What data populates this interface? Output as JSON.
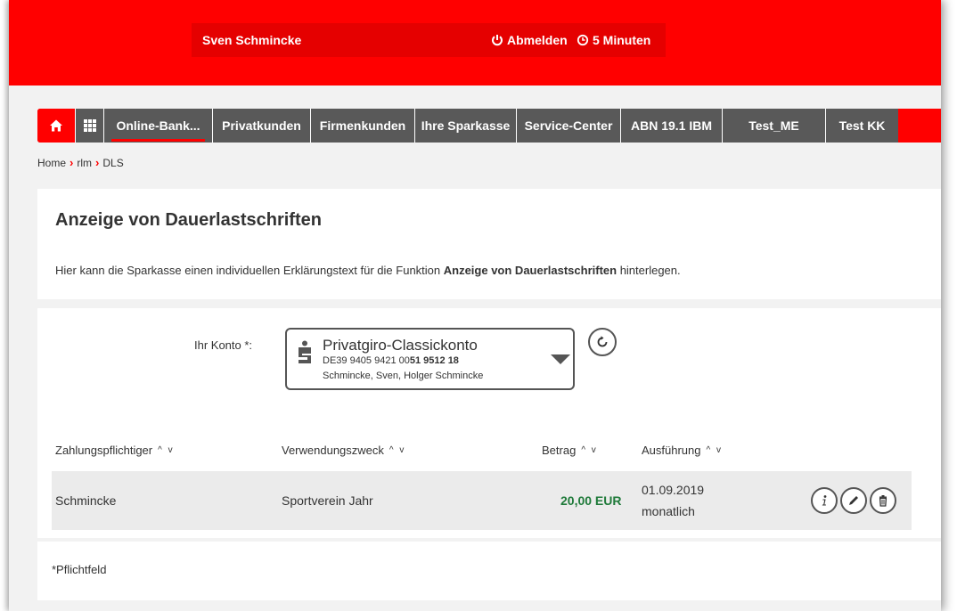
{
  "header": {
    "user_name": "Sven Schmincke",
    "logout_label": "Abmelden",
    "session_timer": "5 Minuten",
    "colors": {
      "brand_red": "#ff0000",
      "nav_gray": "#595959"
    }
  },
  "nav": {
    "home_icon": "home-icon",
    "apps_icon": "apps-grid-icon",
    "items": [
      {
        "label": "Online-Bank..."
      },
      {
        "label": "Privatkunden"
      },
      {
        "label": "Firmenkunden"
      },
      {
        "label": "Ihre Sparkasse"
      },
      {
        "label": "Service-Center"
      },
      {
        "label": "ABN 19.1 IBM"
      },
      {
        "label": "Test_ME"
      },
      {
        "label": "Test KK"
      }
    ]
  },
  "breadcrumb": [
    "Home",
    "rlm",
    "DLS"
  ],
  "intro": {
    "title": "Anzeige von Dauerlastschriften",
    "desc_before": "Hier kann die Sparkasse einen individuellen Erklärungstext für die Funktion ",
    "desc_bold": "Anzeige von Dauerlastschriften",
    "desc_after": " hinterlegen."
  },
  "konto": {
    "label": "Ihr Konto *:",
    "name": "Privatgiro-Classickonto",
    "iban_prefix": "DE39 9405 9421 00",
    "iban_bold": "51 9512 18",
    "owner": "Schmincke, Sven, Holger Schmincke"
  },
  "table": {
    "headers": [
      "Zahlungspflichtiger",
      "Verwendungszweck",
      "Betrag",
      "Ausführung"
    ],
    "sort_glyphs": "^ v",
    "rows": [
      {
        "payer": "Schmincke",
        "purpose": "Sportverein Jahr",
        "amount": "20,00 EUR",
        "date": "01.09.2019",
        "interval": "monatlich"
      }
    ]
  },
  "footer": {
    "required_note": "*Pflichtfeld"
  }
}
